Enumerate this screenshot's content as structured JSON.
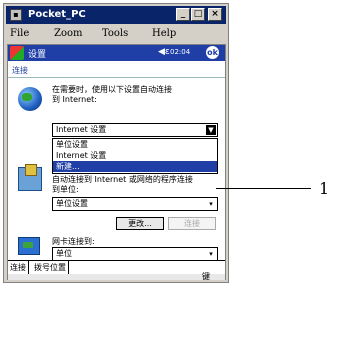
{
  "window": {
    "title": "Pocket_PC",
    "minimize_glyph": "_",
    "maximize_glyph": "□",
    "close_glyph": "×"
  },
  "menubar": {
    "items": [
      "File",
      "Zoom",
      "Tools",
      "Help"
    ]
  },
  "pda": {
    "app_title": "设置",
    "volume_glyph": "◀ε",
    "clock": "02:04",
    "ok_label": "ok",
    "section_title": "连接",
    "instruction_1": "在需要时，使用以下设置自动连接",
    "instruction_2": "到 Internet:",
    "internet_select_value": "Internet 设置",
    "dropdown_options": [
      "单位设置",
      "Internet 设置",
      "新建..."
    ],
    "dropdown_selected_index": 2,
    "work_text": "自动连接到 Internet 或网络的程序连接",
    "work_text_2": "到单位:",
    "work_select_value": "单位设置",
    "modify_button": "更改...",
    "delete_button": "连接",
    "network_card_label": "网卡连接到:",
    "network_select_value": "单位",
    "tabs": [
      "连接",
      "拨号位置"
    ],
    "kbd_icon": "键"
  },
  "annotation": {
    "callout_number": "1"
  }
}
